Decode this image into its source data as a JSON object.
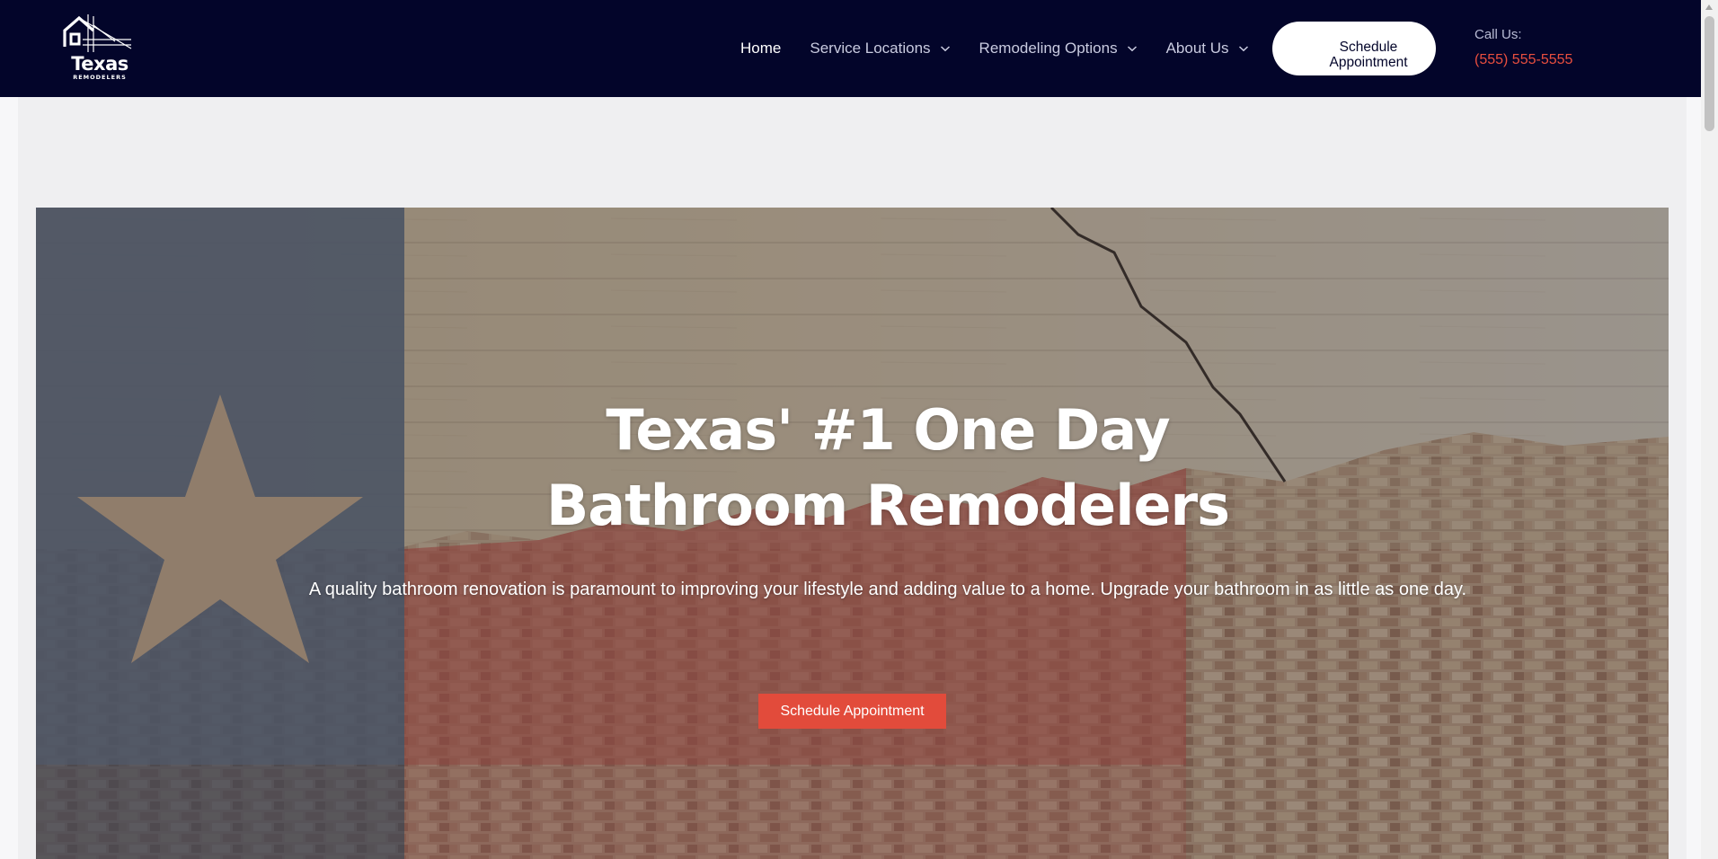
{
  "brand": {
    "name": "Texas",
    "tagline": "REMODELERS"
  },
  "nav": {
    "items": [
      {
        "label": "Home",
        "active": true,
        "has_dropdown": false
      },
      {
        "label": "Service Locations",
        "active": false,
        "has_dropdown": true
      },
      {
        "label": "Remodeling Options",
        "active": false,
        "has_dropdown": true
      },
      {
        "label": "About Us",
        "active": false,
        "has_dropdown": true
      }
    ]
  },
  "header": {
    "cta_label": "Schedule Appointment",
    "call_label": "Call Us:",
    "phone": "(555) 555-5555"
  },
  "hero": {
    "title": "Texas' #1 One Day Bathroom Remodelers",
    "subtitle": "A quality bathroom renovation is paramount to improving your lifestyle and adding value to a home.  Upgrade your bathroom in as little as one day.",
    "cta_label": "Schedule Appointment",
    "background": "texas-flag-painted-brick-wall"
  },
  "colors": {
    "header_bg": "#03052a",
    "accent_red": "#e24b3b",
    "phone_red": "#ea4f3f",
    "page_bg": "#efeff1"
  }
}
